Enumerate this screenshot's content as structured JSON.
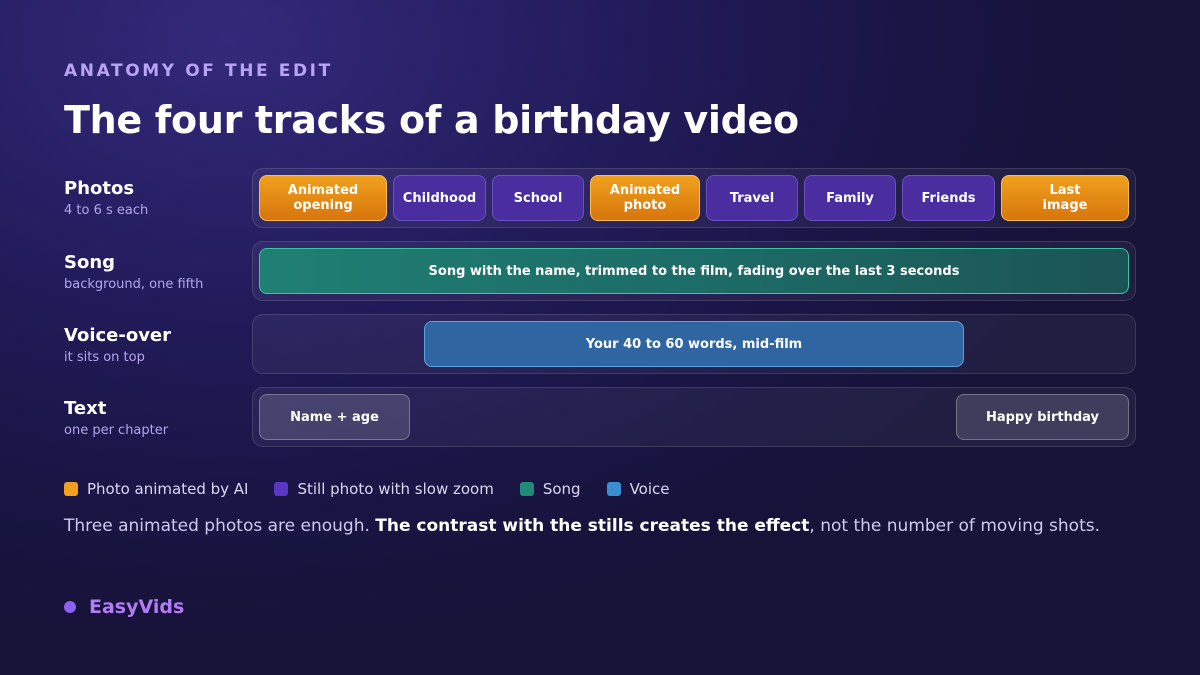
{
  "header": {
    "kicker": "ANATOMY OF THE EDIT",
    "title": "The four tracks of a birthday video"
  },
  "tracks": [
    {
      "name": "Photos",
      "subtitle": "4 to 6 s each",
      "blocks": [
        {
          "label": "Animated\nopening",
          "kind": "ai"
        },
        {
          "label": "Childhood",
          "kind": "still"
        },
        {
          "label": "School",
          "kind": "still"
        },
        {
          "label": "Animated\nphoto",
          "kind": "ai"
        },
        {
          "label": "Travel",
          "kind": "still"
        },
        {
          "label": "Family",
          "kind": "still"
        },
        {
          "label": "Friends",
          "kind": "still"
        },
        {
          "label": "Last\nimage",
          "kind": "ai"
        }
      ]
    },
    {
      "name": "Song",
      "subtitle": "background, one fifth",
      "blocks": [
        {
          "label": "Song with the name, trimmed to the film, fading over the last 3 seconds",
          "kind": "song"
        }
      ]
    },
    {
      "name": "Voice-over",
      "subtitle": "it sits on top",
      "blocks": [
        {
          "label": "Your 40 to 60 words, mid-film",
          "kind": "voice"
        }
      ]
    },
    {
      "name": "Text",
      "subtitle": "one per chapter",
      "blocks": [
        {
          "label": "Name + age",
          "kind": "text"
        },
        {
          "label": "Happy birthday",
          "kind": "text"
        }
      ]
    }
  ],
  "legend": [
    {
      "label": "Photo animated by AI",
      "color": "#f0a01e"
    },
    {
      "label": "Still photo with slow zoom",
      "color": "#5a36c4"
    },
    {
      "label": "Song",
      "color": "#1f8b78"
    },
    {
      "label": "Voice",
      "color": "#3b8ed0"
    }
  ],
  "caption": {
    "lead": "Three animated photos are enough. ",
    "emphasis": "The contrast with the stills creates the effect",
    "tail": ", not the number of moving shots."
  },
  "brand": {
    "name": "EasyVids",
    "dot_color": "#8e5ff0"
  }
}
